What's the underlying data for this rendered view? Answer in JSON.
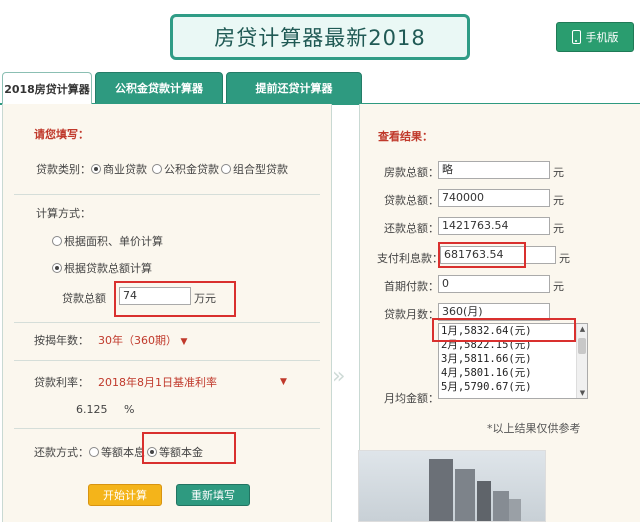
{
  "header": {
    "title": "房贷计算器最新2018",
    "mobile_button": "手机版",
    "mobile_icon": "mobile-phone-icon"
  },
  "tabs": [
    {
      "label": "2018房贷计算器",
      "active": true
    },
    {
      "label": "公积金贷款计算器",
      "active": false
    },
    {
      "label": "提前还贷计算器",
      "active": false
    }
  ],
  "form": {
    "section_title": "请您填写：",
    "loan_type": {
      "label": "贷款类别：",
      "options": [
        "商业贷款",
        "公积金贷款",
        "组合型贷款"
      ],
      "selected": 0
    },
    "calc_method": {
      "label": "计算方式：",
      "options": [
        "根据面积、单价计算",
        "根据贷款总额计算"
      ],
      "selected": 1
    },
    "loan_amount": {
      "label": "贷款总额",
      "value": "74",
      "unit": "万元"
    },
    "term": {
      "label": "按揭年数：",
      "value": "30年（360期）"
    },
    "rate": {
      "label": "贷款利率：",
      "value": "2018年8月1日基准利率",
      "number": "6.125",
      "unit": "%"
    },
    "repay_method": {
      "label": "还款方式：",
      "options": [
        "等额本息",
        "等额本金"
      ],
      "selected": 1
    },
    "buttons": {
      "calculate": "开始计算",
      "reset": "重新填写"
    }
  },
  "results": {
    "section_title": "查看结果：",
    "rows": [
      {
        "label": "房款总额：",
        "value": "略",
        "unit": "元"
      },
      {
        "label": "贷款总额：",
        "value": "740000",
        "unit": "元"
      },
      {
        "label": "还款总额：",
        "value": "1421763.54",
        "unit": "元"
      },
      {
        "label": "支付利息款：",
        "value": "681763.54",
        "unit": "元"
      },
      {
        "label": "首期付款：",
        "value": "0",
        "unit": "元"
      },
      {
        "label": "贷款月数：",
        "value": "360(月)",
        "unit": ""
      }
    ],
    "monthly_label": "月均金额：",
    "monthly_list": [
      "1月,5832.64(元)",
      "2月,5822.15(元)",
      "3月,5811.66(元)",
      "4月,5801.16(元)",
      "5月,5790.67(元)"
    ],
    "note": "*以上结果仅供参考"
  },
  "colors": {
    "accent_green": "#2e9a80",
    "highlight_red": "#d9302e",
    "calc_button": "#f4b41a"
  }
}
